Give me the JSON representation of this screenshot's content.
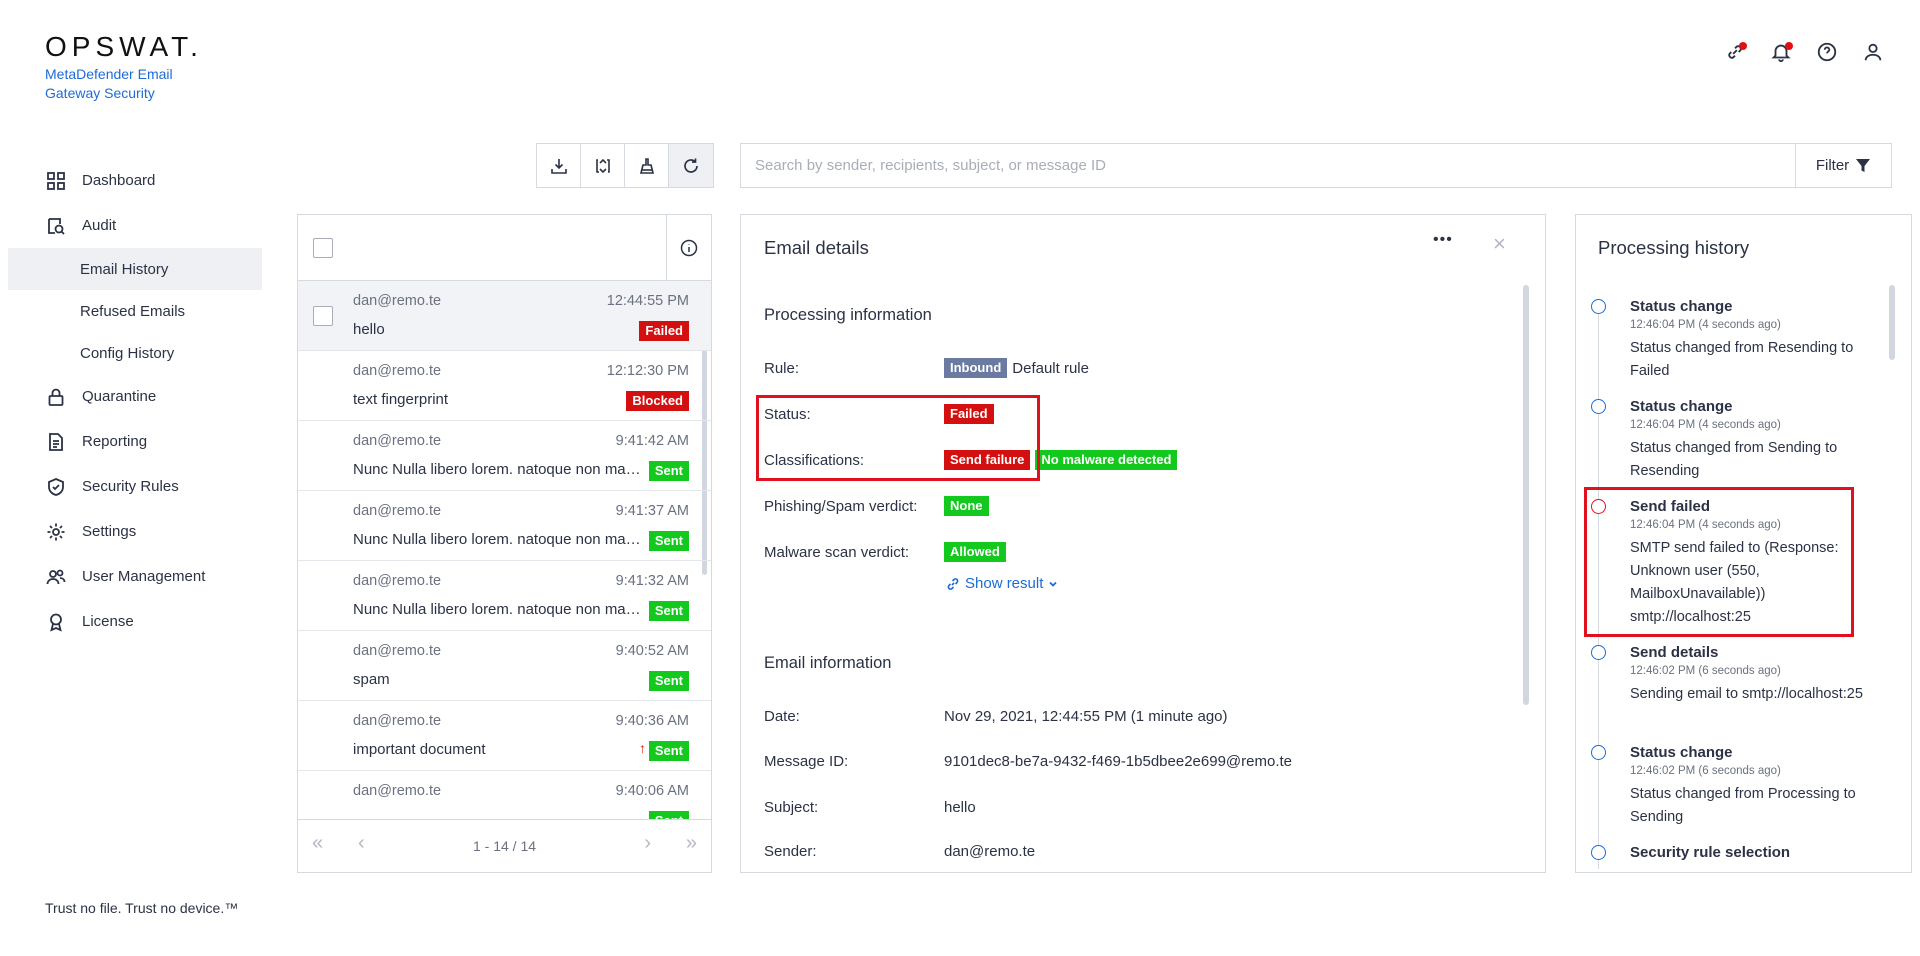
{
  "brand": {
    "logo": "OPSWAT.",
    "product_line1": "MetaDefender Email",
    "product_line2": "Gateway Security"
  },
  "sidebar": {
    "items": [
      {
        "label": "Dashboard",
        "icon": "dashboard-icon"
      },
      {
        "label": "Audit",
        "icon": "audit-icon"
      },
      {
        "label": "Email History",
        "sub": true,
        "active": true
      },
      {
        "label": "Refused Emails",
        "sub": true
      },
      {
        "label": "Config History",
        "sub": true
      },
      {
        "label": "Quarantine",
        "icon": "lock-icon"
      },
      {
        "label": "Reporting",
        "icon": "document-icon"
      },
      {
        "label": "Security Rules",
        "icon": "shield-check-icon"
      },
      {
        "label": "Settings",
        "icon": "gear-icon"
      },
      {
        "label": "User Management",
        "icon": "users-icon"
      },
      {
        "label": "License",
        "icon": "award-icon"
      }
    ],
    "footer": "Trust no file. Trust no device.™"
  },
  "search": {
    "placeholder": "Search by sender, recipients, subject, or message ID",
    "filter_label": "Filter"
  },
  "email_list": {
    "rows": [
      {
        "from": "dan@remo.te",
        "time": "12:44:55 PM",
        "subject": "hello",
        "status": "Failed",
        "status_color": "#d30f0f"
      },
      {
        "from": "dan@remo.te",
        "time": "12:12:30 PM",
        "subject": "text fingerprint",
        "status": "Blocked",
        "status_color": "#d30f0f"
      },
      {
        "from": "dan@remo.te",
        "time": "9:41:42 AM",
        "subject": "Nunc Nulla libero lorem. natoque non massa",
        "status": "Sent",
        "status_color": "#14c91e"
      },
      {
        "from": "dan@remo.te",
        "time": "9:41:37 AM",
        "subject": "Nunc Nulla libero lorem. natoque non massa",
        "status": "Sent",
        "status_color": "#14c91e"
      },
      {
        "from": "dan@remo.te",
        "time": "9:41:32 AM",
        "subject": "Nunc Nulla libero lorem. natoque non massa",
        "status": "Sent",
        "status_color": "#14c91e"
      },
      {
        "from": "dan@remo.te",
        "time": "9:40:52 AM",
        "subject": "spam",
        "status": "Sent",
        "status_color": "#14c91e"
      },
      {
        "from": "dan@remo.te",
        "time": "9:40:36 AM",
        "subject": "important document",
        "status": "Sent",
        "status_color": "#14c91e",
        "priority": "↑"
      },
      {
        "from": "dan@remo.te",
        "time": "9:40:06 AM",
        "subject": "",
        "status": "Sent",
        "status_color": "#14c91e"
      }
    ],
    "pager": {
      "range": "1 - 14 / 14",
      "first": "«",
      "prev": "‹",
      "next": "›",
      "last": "»"
    }
  },
  "details": {
    "title": "Email details",
    "more": "•••",
    "close": "×",
    "processing_title": "Processing information",
    "rule_label": "Rule:",
    "rule_badge": "Inbound",
    "rule_value": "Default rule",
    "status_label": "Status:",
    "status_value": "Failed",
    "class_label": "Classifications:",
    "class_values": [
      "Send failure",
      "No malware detected"
    ],
    "phish_label": "Phishing/Spam verdict:",
    "phish_value": "None",
    "malware_label": "Malware scan verdict:",
    "malware_value": "Allowed",
    "show_result": "Show result",
    "email_info_title": "Email information",
    "date_label": "Date:",
    "date_value": "Nov 29, 2021, 12:44:55 PM (1 minute ago)",
    "msgid_label": "Message ID:",
    "msgid_value": "9101dec8-be7a-9432-f469-1b5dbee2e699@remo.te",
    "subject_label": "Subject:",
    "subject_value": "hello",
    "sender_label": "Sender:",
    "sender_value": "dan@remo.te"
  },
  "history": {
    "title": "Processing history",
    "items": [
      {
        "title": "Status change",
        "time": "12:46:04 PM (4 seconds ago)",
        "desc": "Status changed from Resending to Failed"
      },
      {
        "title": "Status change",
        "time": "12:46:04 PM (4 seconds ago)",
        "desc": "Status changed from Sending to Resending"
      },
      {
        "title": "Send failed",
        "time": "12:46:04 PM (4 seconds ago)",
        "desc": "SMTP send failed to (Response: Unknown user (550, MailboxUnavailable))",
        "link": "smtp://localhost:25"
      },
      {
        "title": "Send details",
        "time": "12:46:02 PM (6 seconds ago)",
        "desc": "Sending email to smtp://localhost:25"
      },
      {
        "title": "Status change",
        "time": "12:46:02 PM (6 seconds ago)",
        "desc": "Status changed from Processing to Sending"
      },
      {
        "title": "Security rule selection",
        "time": "",
        "desc": ""
      }
    ]
  }
}
